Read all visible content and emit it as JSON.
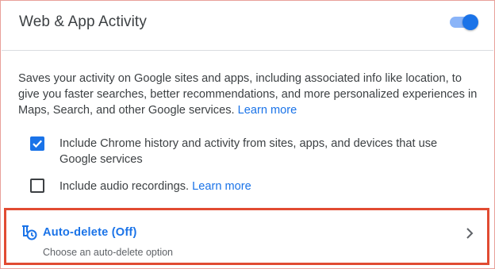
{
  "header": {
    "title": "Web & App Activity",
    "toggle_on": true
  },
  "description": {
    "text": "Saves your activity on Google sites and apps, including associated info like location, to give you faster searches, better recommendations, and more personalized experiences in Maps, Search, and other Google services.",
    "link": "Learn more"
  },
  "options": [
    {
      "label": "Include Chrome history and activity from sites, apps, and devices that use Google services",
      "checked": true
    },
    {
      "label": "Include audio recordings.",
      "link": "Learn more",
      "checked": false
    }
  ],
  "auto_delete": {
    "title": "Auto-delete (Off)",
    "subtitle": "Choose an auto-delete option",
    "icon": "auto-delete-icon"
  },
  "colors": {
    "accent": "#1a73e8",
    "toggle_track": "#8ab4f8",
    "highlight_border": "#e14b32"
  }
}
